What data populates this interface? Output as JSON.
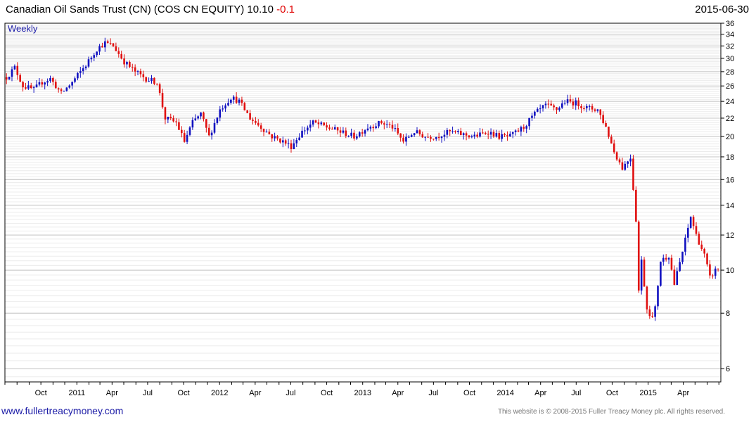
{
  "header": {
    "title": "Canadian Oil Sands Trust (CN) (COS CN EQUITY) 10.10",
    "change": "-0.1",
    "date": "2015-06-30"
  },
  "footer": {
    "link": "www.fullertreacymoney.com",
    "copyright": "This website is © 2008-2015 Fuller Treacy Money plc. All rights reserved."
  },
  "colors": {
    "up": "#1010c0",
    "down": "#e01010",
    "grid": "#d0d0d0",
    "frame": "#000000"
  },
  "chart_data": {
    "type": "candlestick",
    "title": "Canadian Oil Sands Trust (CN) (COS CN EQUITY) 10.10 -0.1",
    "period_label": "Weekly",
    "y_scale": "log",
    "ylim": [
      5.6,
      36
    ],
    "y_ticks": [
      6,
      8,
      10,
      12,
      14,
      16,
      18,
      20,
      22,
      24,
      26,
      28,
      30,
      32,
      34,
      36
    ],
    "x_range": [
      "2010-07-01",
      "2015-07-06"
    ],
    "x_ticks": [
      {
        "date": "2010-10-01",
        "label": "Oct"
      },
      {
        "date": "2011-01-01",
        "label": "2011"
      },
      {
        "date": "2011-04-01",
        "label": "Apr"
      },
      {
        "date": "2011-07-01",
        "label": "Jul"
      },
      {
        "date": "2011-10-01",
        "label": "Oct"
      },
      {
        "date": "2012-01-01",
        "label": "2012"
      },
      {
        "date": "2012-04-01",
        "label": "Apr"
      },
      {
        "date": "2012-07-01",
        "label": "Jul"
      },
      {
        "date": "2012-10-01",
        "label": "Oct"
      },
      {
        "date": "2013-01-01",
        "label": "2013"
      },
      {
        "date": "2013-04-01",
        "label": "Apr"
      },
      {
        "date": "2013-07-01",
        "label": "Jul"
      },
      {
        "date": "2013-10-01",
        "label": "Oct"
      },
      {
        "date": "2014-01-01",
        "label": "2014"
      },
      {
        "date": "2014-04-01",
        "label": "Apr"
      },
      {
        "date": "2014-07-01",
        "label": "Jul"
      },
      {
        "date": "2014-10-01",
        "label": "Oct"
      },
      {
        "date": "2015-01-01",
        "label": "2015"
      },
      {
        "date": "2015-04-01",
        "label": "Apr"
      }
    ],
    "close_path": [
      [
        "2010-07-05",
        27.2
      ],
      [
        "2010-07-26",
        28.6
      ],
      [
        "2010-08-16",
        26.0
      ],
      [
        "2010-09-13",
        25.5
      ],
      [
        "2010-10-04",
        26.5
      ],
      [
        "2010-10-25",
        27.0
      ],
      [
        "2010-11-22",
        25.0
      ],
      [
        "2010-12-20",
        26.5
      ],
      [
        "2011-01-24",
        29.0
      ],
      [
        "2011-02-21",
        31.5
      ],
      [
        "2011-03-14",
        32.5
      ],
      [
        "2011-04-04",
        32.0
      ],
      [
        "2011-05-02",
        29.5
      ],
      [
        "2011-05-30",
        28.0
      ],
      [
        "2011-06-27",
        27.0
      ],
      [
        "2011-07-25",
        26.5
      ],
      [
        "2011-08-15",
        22.0
      ],
      [
        "2011-09-12",
        21.5
      ],
      [
        "2011-10-03",
        19.5
      ],
      [
        "2011-10-24",
        21.5
      ],
      [
        "2011-11-14",
        22.5
      ],
      [
        "2011-12-05",
        20.0
      ],
      [
        "2012-01-02",
        23.0
      ],
      [
        "2012-01-30",
        24.5
      ],
      [
        "2012-02-20",
        24.0
      ],
      [
        "2012-03-19",
        22.0
      ],
      [
        "2012-04-16",
        21.0
      ],
      [
        "2012-05-14",
        20.0
      ],
      [
        "2012-06-11",
        19.5
      ],
      [
        "2012-07-02",
        19.0
      ],
      [
        "2012-07-30",
        20.5
      ],
      [
        "2012-08-27",
        21.5
      ],
      [
        "2012-10-01",
        21.0
      ],
      [
        "2012-11-05",
        20.5
      ],
      [
        "2012-12-10",
        20.0
      ],
      [
        "2013-01-14",
        21.0
      ],
      [
        "2013-02-18",
        21.5
      ],
      [
        "2013-03-18",
        21.0
      ],
      [
        "2013-04-15",
        19.5
      ],
      [
        "2013-05-13",
        20.5
      ],
      [
        "2013-06-10",
        20.0
      ],
      [
        "2013-07-08",
        20.0
      ],
      [
        "2013-08-12",
        20.5
      ],
      [
        "2013-09-16",
        20.2
      ],
      [
        "2013-10-14",
        20.0
      ],
      [
        "2013-11-18",
        20.5
      ],
      [
        "2013-12-16",
        20.0
      ],
      [
        "2014-01-13",
        20.0
      ],
      [
        "2014-02-17",
        21.0
      ],
      [
        "2014-03-17",
        22.5
      ],
      [
        "2014-04-14",
        23.5
      ],
      [
        "2014-05-12",
        23.0
      ],
      [
        "2014-06-02",
        24.0
      ],
      [
        "2014-06-30",
        23.8
      ],
      [
        "2014-07-28",
        23.2
      ],
      [
        "2014-08-25",
        23.0
      ],
      [
        "2014-09-15",
        21.0
      ],
      [
        "2014-10-06",
        18.5
      ],
      [
        "2014-10-27",
        17.0
      ],
      [
        "2014-11-17",
        18.0
      ],
      [
        "2014-12-01",
        13.0
      ],
      [
        "2014-12-08",
        9.0
      ],
      [
        "2014-12-15",
        10.5
      ],
      [
        "2014-12-29",
        8.2
      ],
      [
        "2015-01-12",
        7.8
      ],
      [
        "2015-01-19",
        8.2
      ],
      [
        "2015-02-02",
        10.5
      ],
      [
        "2015-02-23",
        10.8
      ],
      [
        "2015-03-09",
        9.3
      ],
      [
        "2015-03-30",
        11.0
      ],
      [
        "2015-04-20",
        13.2
      ],
      [
        "2015-05-04",
        12.0
      ],
      [
        "2015-05-25",
        10.8
      ],
      [
        "2015-06-08",
        9.6
      ],
      [
        "2015-06-22",
        10.0
      ],
      [
        "2015-06-29",
        10.1
      ]
    ]
  }
}
